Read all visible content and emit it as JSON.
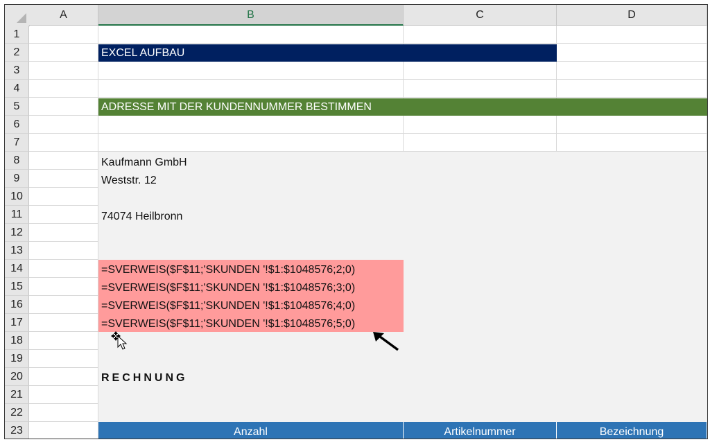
{
  "columns": [
    "A",
    "B",
    "C",
    "D"
  ],
  "rows": [
    "1",
    "2",
    "3",
    "4",
    "5",
    "6",
    "7",
    "8",
    "9",
    "10",
    "11",
    "12",
    "13",
    "14",
    "15",
    "16",
    "17",
    "18",
    "19",
    "20",
    "21",
    "22",
    "23"
  ],
  "title_band": "EXCEL AUFBAU",
  "section_band": "ADRESSE MIT DER KUNDENNUMMER BESTIMMEN",
  "address": {
    "line1": "Kaufmann GmbH",
    "line2": "Weststr. 12",
    "line3": "74074 Heilbronn"
  },
  "formulas": [
    "=SVERWEIS($F$11;'SKUNDEN '!$1:$1048576;2;0)",
    "=SVERWEIS($F$11;'SKUNDEN '!$1:$1048576;3;0)",
    "=SVERWEIS($F$11;'SKUNDEN '!$1:$1048576;4;0)",
    "=SVERWEIS($F$11;'SKUNDEN '!$1:$1048576;5;0)"
  ],
  "invoice_heading": "RECHNUNG",
  "table_headers": [
    "Anzahl",
    "Artikelnummer",
    "Bezeichnung"
  ],
  "colors": {
    "title_band": "#002060",
    "section_band": "#548235",
    "formula_fill": "#ff9b9b",
    "table_header": "#2e74b5",
    "selected_column": "#217346"
  }
}
